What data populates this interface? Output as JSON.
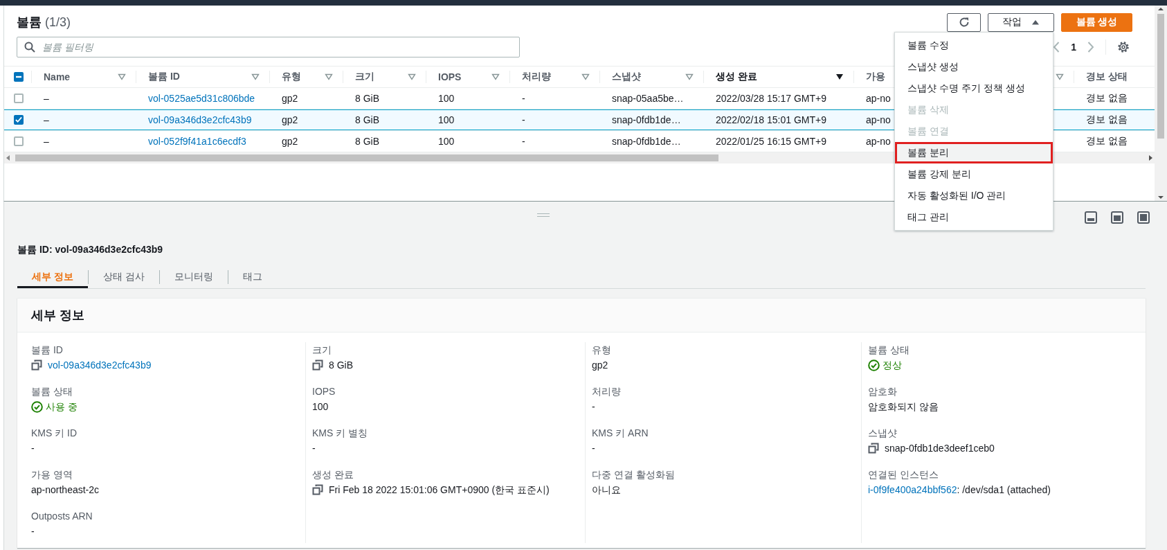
{
  "header": {
    "title": "볼륨",
    "count": "(1/3)"
  },
  "toolbar": {
    "actions": {
      "label": "작업",
      "expanded": true
    },
    "create": "볼륨 생성"
  },
  "filter": {
    "placeholder": "볼륨 필터링"
  },
  "pagination": {
    "page": "1"
  },
  "table": {
    "select_all": {
      "indeterminate": true
    },
    "columns": [
      {
        "label": "Name",
        "kind": "sortable",
        "sorted": false,
        "link": false
      },
      {
        "label": "볼륨 ID",
        "kind": "sortable",
        "sorted": false,
        "link": true
      },
      {
        "label": "유형",
        "kind": "sortable",
        "sorted": false,
        "link": false
      },
      {
        "label": "크기",
        "kind": "sortable",
        "sorted": false,
        "link": false
      },
      {
        "label": "IOPS",
        "kind": "sortable",
        "sorted": false,
        "link": false
      },
      {
        "label": "처리량",
        "kind": "sortable",
        "sorted": false,
        "link": false
      },
      {
        "label": "스냅샷",
        "kind": "sortable",
        "sorted": false,
        "link": false
      },
      {
        "label": "생성 완료",
        "kind": "sortable",
        "sorted": true,
        "link": false
      },
      {
        "label": "가용",
        "kind": "sortable",
        "sorted": false,
        "link": false
      },
      {
        "label": "경보 상태",
        "kind": "plain",
        "link": false
      }
    ],
    "rows": [
      {
        "selected": false,
        "cells": [
          "–",
          "vol-0525ae5d31c806bde",
          "gp2",
          "8 GiB",
          "100",
          "-",
          "snap-05aa5be…",
          "2022/03/28 15:17 GMT+9",
          "ap-no",
          "경보 없음"
        ]
      },
      {
        "selected": true,
        "cells": [
          "–",
          "vol-09a346d3e2cfc43b9",
          "gp2",
          "8 GiB",
          "100",
          "-",
          "snap-0fdb1de…",
          "2022/02/18 15:01 GMT+9",
          "ap-no",
          "경보 없음"
        ]
      },
      {
        "selected": false,
        "cells": [
          "–",
          "vol-052f9f41a1c6ecdf3",
          "gp2",
          "8 GiB",
          "100",
          "-",
          "snap-0fdb1de…",
          "2022/01/25 16:15 GMT+9",
          "ap-no",
          "경보 없음"
        ]
      }
    ]
  },
  "menu": {
    "items": [
      {
        "label": "볼륨 수정",
        "disabled": false,
        "highlighted": false
      },
      {
        "label": "스냅샷 생성",
        "disabled": false,
        "highlighted": false
      },
      {
        "label": "스냅샷 수명 주기 정책 생성",
        "disabled": false,
        "highlighted": false
      },
      {
        "label": "볼륨 삭제",
        "disabled": true,
        "highlighted": false
      },
      {
        "label": "볼륨 연결",
        "disabled": true,
        "highlighted": false
      },
      {
        "label": "볼륨 분리",
        "disabled": false,
        "highlighted": true
      },
      {
        "label": "볼륨 강제 분리",
        "disabled": false,
        "highlighted": false
      },
      {
        "label": "자동 활성화된 I/O 관리",
        "disabled": false,
        "highlighted": false
      },
      {
        "label": "태그 관리",
        "disabled": false,
        "highlighted": false
      }
    ]
  },
  "detail": {
    "title": "볼륨 ID: vol-09a346d3e2cfc43b9",
    "tabs": [
      {
        "label": "세부 정보",
        "selected": true
      },
      {
        "label": "상태 검사",
        "selected": false
      },
      {
        "label": "모니터링",
        "selected": false
      },
      {
        "label": "태그",
        "selected": false
      }
    ],
    "card": {
      "title": "세부 정보",
      "columns": [
        [
          {
            "label": "볼륨 ID",
            "kind": "copy-link",
            "value": "vol-09a346d3e2cfc43b9"
          },
          {
            "label": "볼륨 상태",
            "kind": "status",
            "value": "사용 중"
          },
          {
            "label": "KMS 키 ID",
            "kind": "text",
            "value": "-"
          },
          {
            "label": "가용 영역",
            "kind": "text",
            "value": "ap-northeast-2c"
          },
          {
            "label": "Outposts ARN",
            "kind": "text",
            "value": "-"
          }
        ],
        [
          {
            "label": "크기",
            "kind": "copy",
            "value": "8 GiB"
          },
          {
            "label": "IOPS",
            "kind": "text",
            "value": "100"
          },
          {
            "label": "KMS 키 별칭",
            "kind": "text",
            "value": "-"
          },
          {
            "label": "생성 완료",
            "kind": "copy",
            "value": "Fri Feb 18 2022 15:01:06 GMT+0900 (한국 표준시)"
          }
        ],
        [
          {
            "label": "유형",
            "kind": "text",
            "value": "gp2"
          },
          {
            "label": "처리량",
            "kind": "text",
            "value": "-"
          },
          {
            "label": "KMS 키 ARN",
            "kind": "text",
            "value": "-"
          },
          {
            "label": "다중 연결 활성화됨",
            "kind": "text",
            "value": "아니요"
          }
        ],
        [
          {
            "label": "볼륨 상태",
            "kind": "status",
            "value": "정상"
          },
          {
            "label": "암호화",
            "kind": "text",
            "value": "암호화되지 않음"
          },
          {
            "label": "스냅샷",
            "kind": "copy",
            "value": "snap-0fdb1de3deef1ceb0"
          },
          {
            "label": "연결된 인스턴스",
            "kind": "instance",
            "link": "i-0f9fe400a24bbf562",
            "value": ": /dev/sda1 (attached)"
          }
        ]
      ]
    }
  }
}
